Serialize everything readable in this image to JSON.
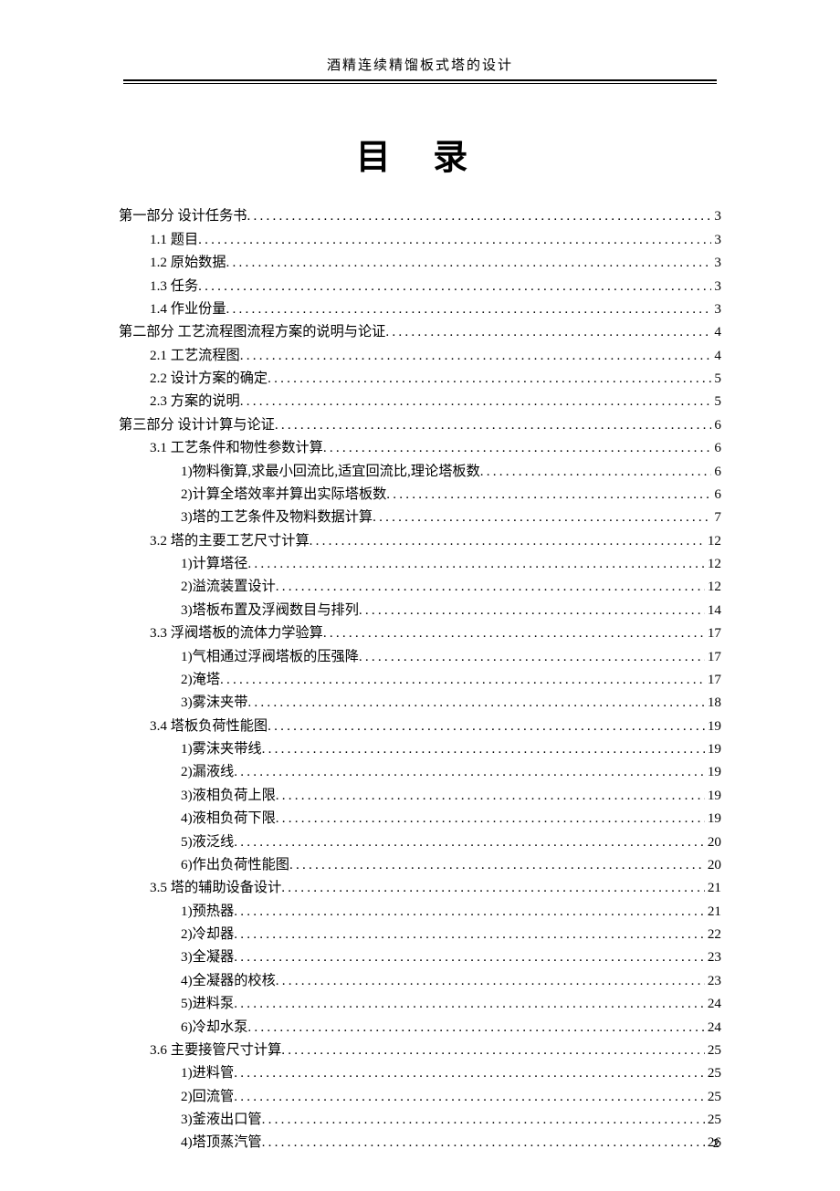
{
  "header": "酒精连续精馏板式塔的设计",
  "title": "目 录",
  "page_number": "2",
  "toc": [
    {
      "level": 1,
      "label": "第一部分  设计任务书",
      "page": "3"
    },
    {
      "level": 2,
      "label": "1.1 题目",
      "page": "3"
    },
    {
      "level": 2,
      "label": "1.2 原始数据",
      "page": "3"
    },
    {
      "level": 2,
      "label": "1.3 任务",
      "page": "3"
    },
    {
      "level": 2,
      "label": "1.4 作业份量",
      "page": "3"
    },
    {
      "level": 1,
      "label": "第二部分  工艺流程图流程方案的说明与论证",
      "page": "4"
    },
    {
      "level": 2,
      "label": "2.1 工艺流程图",
      "page": "4"
    },
    {
      "level": 2,
      "label": "2.2 设计方案的确定",
      "page": "5"
    },
    {
      "level": 2,
      "label": "2.3 方案的说明",
      "page": "5"
    },
    {
      "level": 1,
      "label": "第三部分  设计计算与论证",
      "page": "6"
    },
    {
      "level": 2,
      "label": "3.1 工艺条件和物性参数计算",
      "page": "6"
    },
    {
      "level": 3,
      "label": "1)物料衡算,求最小回流比,适宜回流比,理论塔板数",
      "page": "6"
    },
    {
      "level": 3,
      "label": "2)计算全塔效率并算出实际塔板数",
      "page": "6"
    },
    {
      "level": 3,
      "label": "3)塔的工艺条件及物料数据计算",
      "page": "7"
    },
    {
      "level": 2,
      "label": "3.2 塔的主要工艺尺寸计算",
      "page": "12"
    },
    {
      "level": 3,
      "label": "1)计算塔径",
      "page": "12"
    },
    {
      "level": 3,
      "label": "2)溢流装置设计",
      "page": "12"
    },
    {
      "level": 3,
      "label": "3)塔板布置及浮阀数目与排列",
      "page": "14"
    },
    {
      "level": 2,
      "label": "3.3 浮阀塔板的流体力学验算",
      "page": "17"
    },
    {
      "level": 3,
      "label": "1)气相通过浮阀塔板的压强降",
      "page": "17"
    },
    {
      "level": 3,
      "label": "2)淹塔",
      "page": "17"
    },
    {
      "level": 3,
      "label": "3)雾沫夹带",
      "page": "18"
    },
    {
      "level": 2,
      "label": "3.4 塔板负荷性能图",
      "page": "19"
    },
    {
      "level": 3,
      "label": "1)雾沫夹带线",
      "page": "19"
    },
    {
      "level": 3,
      "label": "2)漏液线",
      "page": "19"
    },
    {
      "level": 3,
      "label": "3)液相负荷上限",
      "page": "19"
    },
    {
      "level": 3,
      "label": "4)液相负荷下限",
      "page": "19"
    },
    {
      "level": 3,
      "label": "5)液泛线",
      "page": "20"
    },
    {
      "level": 3,
      "label": "6)作出负荷性能图",
      "page": "20"
    },
    {
      "level": 2,
      "label": "3.5 塔的辅助设备设计",
      "page": "21"
    },
    {
      "level": 3,
      "label": "1)预热器",
      "page": "21"
    },
    {
      "level": 3,
      "label": "2)冷却器",
      "page": "22"
    },
    {
      "level": 3,
      "label": "3)全凝器",
      "page": "23"
    },
    {
      "level": 3,
      "label": "4)全凝器的校核",
      "page": "23"
    },
    {
      "level": 3,
      "label": "5)进料泵",
      "page": "24"
    },
    {
      "level": 3,
      "label": "6)冷却水泵",
      "page": "24"
    },
    {
      "level": 2,
      "label": "3.6 主要接管尺寸计算",
      "page": "25"
    },
    {
      "level": 3,
      "label": "1)进料管",
      "page": "25"
    },
    {
      "level": 3,
      "label": "2)回流管",
      "page": "25"
    },
    {
      "level": 3,
      "label": "3)釜液出口管",
      "page": "25"
    },
    {
      "level": 3,
      "label": "4)塔顶蒸汽管",
      "page": "26"
    }
  ]
}
